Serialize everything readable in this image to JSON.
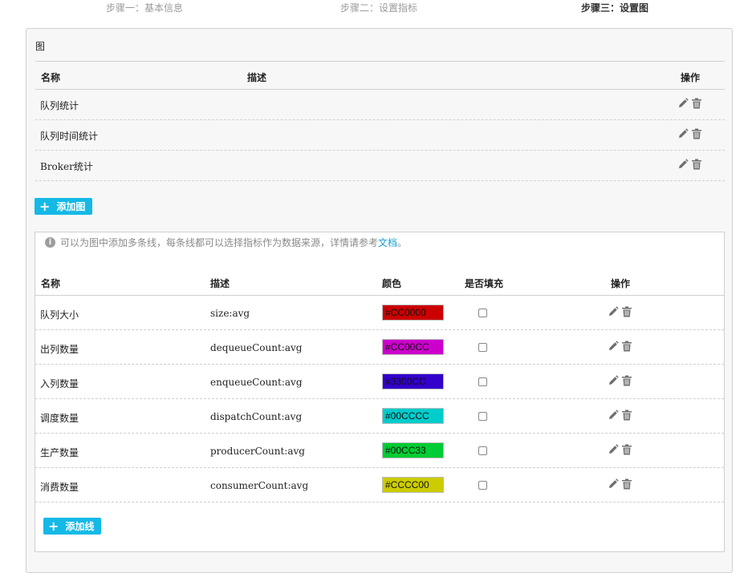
{
  "steps": [
    {
      "label": "步骤一：基本信息",
      "active": false
    },
    {
      "label": "步骤二：设置指标",
      "active": false
    },
    {
      "label": "步骤三：设置图",
      "active": true
    }
  ],
  "panel": {
    "title": "图",
    "columns": {
      "name": "名称",
      "desc": "描述",
      "op": "操作"
    },
    "charts": [
      {
        "name": "队列统计"
      },
      {
        "name": "队列时间统计"
      },
      {
        "name": "Broker统计"
      }
    ],
    "add_chart_label": "添加图"
  },
  "lines": {
    "info_text": "可以为图中添加多条线，每条线都可以选择指标作为数据来源，详情请参考",
    "info_link": "文档",
    "info_end": "。",
    "columns": {
      "name": "名称",
      "desc": "描述",
      "color": "颜色",
      "fill": "是否填充",
      "op": "操作"
    },
    "rows": [
      {
        "name": "队列大小",
        "desc": "size:avg",
        "color": "#CC0000",
        "fill": false
      },
      {
        "name": "出列数量",
        "desc": "dequeueCount:avg",
        "color": "#CC00CC",
        "fill": false
      },
      {
        "name": "入列数量",
        "desc": "enqueueCount:avg",
        "color": "#3300CC",
        "fill": false
      },
      {
        "name": "调度数量",
        "desc": "dispatchCount:avg",
        "color": "#00CCCC",
        "fill": false
      },
      {
        "name": "生产数量",
        "desc": "producerCount:avg",
        "color": "#00CC33",
        "fill": false
      },
      {
        "name": "消费数量",
        "desc": "consumerCount:avg",
        "color": "#CCCC00",
        "fill": false
      }
    ],
    "add_line_label": "添加线"
  },
  "icons": {
    "edit": "pencil-icon",
    "delete": "trash-icon",
    "info": "info-icon",
    "add": "plus-icon"
  }
}
